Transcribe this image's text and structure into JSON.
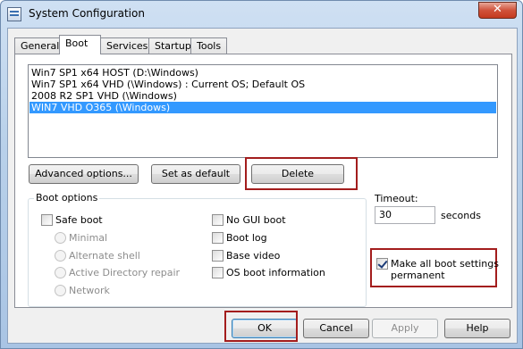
{
  "window": {
    "title": "System Configuration",
    "close_glyph": "✕"
  },
  "tabs": [
    {
      "label": "General"
    },
    {
      "label": "Boot"
    },
    {
      "label": "Services"
    },
    {
      "label": "Startup"
    },
    {
      "label": "Tools"
    }
  ],
  "boot_entries": [
    {
      "label": "Win7 SP1 x64 HOST (D:\\Windows)"
    },
    {
      "label": "Win7 SP1 x64 VHD (\\Windows) : Current OS; Default OS"
    },
    {
      "label": "2008 R2 SP1 VHD (\\Windows)"
    },
    {
      "label": "WIN7 VHD O365 (\\Windows)",
      "selected": true
    }
  ],
  "buttons": {
    "advanced": "Advanced options...",
    "set_default": "Set as default",
    "delete": "Delete",
    "ok": "OK",
    "cancel": "Cancel",
    "apply": "Apply",
    "help": "Help"
  },
  "boot_options": {
    "title": "Boot options",
    "safe_boot": {
      "label": "Safe boot",
      "checked": false
    },
    "minimal": "Minimal",
    "alternate_shell": "Alternate shell",
    "ad_repair": "Active Directory repair",
    "network": "Network",
    "no_gui_boot": {
      "label": "No GUI boot",
      "checked": false
    },
    "boot_log": {
      "label": "Boot log",
      "checked": false
    },
    "base_video": {
      "label": "Base video",
      "checked": false
    },
    "os_boot_info": {
      "label": "OS boot information",
      "checked": false
    }
  },
  "timeout": {
    "label": "Timeout:",
    "value": "30",
    "unit": "seconds"
  },
  "permanent": {
    "label_line1": "Make all boot settings",
    "label_line2": "permanent",
    "checked": true
  },
  "colors": {
    "highlight": "#a31d1d",
    "selection": "#3399ff"
  }
}
